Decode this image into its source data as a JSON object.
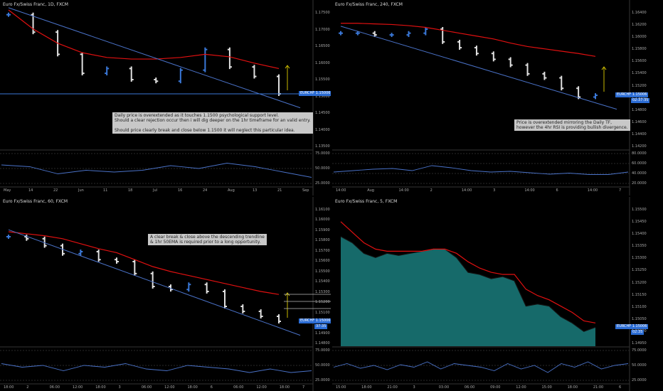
{
  "panels": [
    {
      "title": "Euro Fx/Swiss Franc, 1D, FXCM",
      "symbol": "EURCHF",
      "price": "1.15006",
      "countdown": "",
      "note": "Daily price is overextended as it touches 1.1500 psychological support level.\nShould a clear rejection occur then i will dig deeper on the 1hr timeframe for an valid entry.\n\nShould price clearly break and close below 1.1500 it will neglect this particular idea.",
      "yticks": [
        "1.17500",
        "1.17000",
        "1.16500",
        "1.16000",
        "1.15500",
        "1.15000",
        "1.14500",
        "1.14000",
        "1.13500"
      ],
      "osc_ticks": [
        "75.0000",
        "50.0000",
        "25.0000"
      ],
      "xticks": [
        "May",
        "14",
        "22",
        "Jun",
        "11",
        "18",
        "Jul",
        "16",
        "24",
        "Aug",
        "13",
        "21",
        "Sep"
      ],
      "fibs": []
    },
    {
      "title": "Euro Fx/Swiss Franc, 240, FXCM",
      "symbol": "EURCHF",
      "price": "1.15006",
      "countdown": "02:37:35",
      "note": "Price is overextended mirroring the Daily TF,\nhowever the 4hr RSI is providing bullish divergence.",
      "yticks": [
        "1.16400",
        "1.16200",
        "1.16000",
        "1.15800",
        "1.15600",
        "1.15400",
        "1.15200",
        "1.15000",
        "1.14800",
        "1.14600",
        "1.14400",
        "1.14200"
      ],
      "osc_ticks": [
        "80.0000",
        "60.0000",
        "40.0000",
        "20.0000"
      ],
      "xticks": [
        "14:00",
        "Aug",
        "14:00",
        "2",
        "14:00",
        "3",
        "14:00",
        "6",
        "14:00",
        "7"
      ],
      "fibs": []
    },
    {
      "title": "Euro Fx/Swiss Franc, 60, FXCM",
      "symbol": "EURCHF",
      "price": "1.15006",
      "countdown": "37:35",
      "note": "A clear break & close above the descending trendline\n& 1hr 50EMA is required prior to a long opportunity.",
      "yticks": [
        "1.16100",
        "1.16000",
        "1.15900",
        "1.15800",
        "1.15700",
        "1.15600",
        "1.15500",
        "1.15400",
        "1.15300",
        "1.15200",
        "1.15100",
        "1.15000",
        "1.14900",
        "1.14800"
      ],
      "osc_ticks": [
        "75.0000",
        "50.0000",
        "25.0000"
      ],
      "xticks": [
        "18:00",
        "2",
        "06:00",
        "12:00",
        "18:00",
        "3",
        "06:00",
        "12:00",
        "18:00",
        "6",
        "06:00",
        "12:00",
        "18:00",
        "7"
      ],
      "fibs": [
        "38.20%",
        "50.00%",
        "61.80%"
      ]
    },
    {
      "title": "Euro Fx/Swiss Franc, 5, FXCM",
      "symbol": "EURCHF",
      "price": "1.15006",
      "countdown": "02:35",
      "note": "",
      "yticks": [
        "1.15500",
        "1.15450",
        "1.15400",
        "1.15350",
        "1.15300",
        "1.15250",
        "1.15200",
        "1.15150",
        "1.15100",
        "1.15050",
        "1.15000",
        "1.14950"
      ],
      "osc_ticks": [
        "75.0000",
        "50.0000",
        "25.0000"
      ],
      "xticks": [
        "15:00",
        "18:00",
        "21:00",
        "3",
        "03:00",
        "06:00",
        "09:00",
        "12:00",
        "15:00",
        "18:00",
        "21:00",
        "6"
      ],
      "fibs": []
    }
  ],
  "chart_data": [
    {
      "type": "bar",
      "title": "Euro Fx/Swiss Franc, 1D, FXCM",
      "x": [
        "May",
        "14",
        "22",
        "Jun",
        "11",
        "18",
        "Jul",
        "16",
        "24",
        "Aug"
      ],
      "series": [
        {
          "values": [
            1.1765,
            1.171,
            1.164,
            1.158,
            1.1595,
            1.156,
            1.1555,
            1.159,
            1.1655,
            1.16,
            1.157,
            1.1515
          ]
        }
      ],
      "ema": [
        1.178,
        1.172,
        1.1675,
        1.1645,
        1.163,
        1.1625,
        1.1625,
        1.163,
        1.164,
        1.1632,
        1.1612,
        1.1595
      ],
      "osc": [
        60,
        55,
        35,
        45,
        40,
        45,
        58,
        50,
        65,
        55,
        40,
        25
      ],
      "ylim": [
        1.134,
        1.178
      ]
    },
    {
      "type": "bar",
      "title": "Euro Fx/Swiss Franc, 240, FXCM",
      "series": [
        {
          "values": [
            1.1615,
            1.1615,
            1.1612,
            1.1612,
            1.1615,
            1.1622,
            1.16,
            1.159,
            1.158,
            1.157,
            1.156,
            1.1545,
            1.1538,
            1.152,
            1.1505,
            1.1508
          ]
        }
      ],
      "ema": [
        1.1632,
        1.1632,
        1.1631,
        1.163,
        1.1628,
        1.1625,
        1.162,
        1.1615,
        1.161,
        1.1605,
        1.1598,
        1.1592,
        1.1588,
        1.1584,
        1.158,
        1.1575
      ],
      "osc": [
        40,
        44,
        48,
        50,
        44,
        58,
        52,
        44,
        40,
        42,
        38,
        34,
        37,
        33,
        33,
        40
      ],
      "ylim": [
        1.1415,
        1.1655
      ]
    },
    {
      "type": "bar",
      "title": "Euro Fx/Swiss Franc, 60, FXCM",
      "series": [
        {
          "values": [
            1.1585,
            1.1583,
            1.1576,
            1.1568,
            1.157,
            1.1562,
            1.156,
            1.1548,
            1.1535,
            1.1532,
            1.1537,
            1.153,
            1.1515,
            1.151,
            1.1505,
            1.15
          ]
        }
      ],
      "ema": [
        1.159,
        1.1588,
        1.1586,
        1.1583,
        1.1578,
        1.1573,
        1.1569,
        1.1562,
        1.1555,
        1.155,
        1.1546,
        1.1542,
        1.1538,
        1.1534,
        1.153,
        1.1527
      ],
      "osc": [
        55,
        45,
        50,
        35,
        50,
        45,
        55,
        40,
        35,
        50,
        45,
        40,
        30,
        40,
        30,
        35
      ],
      "ylim": [
        1.1475,
        1.1615
      ]
    },
    {
      "type": "area",
      "title": "Euro Fx/Swiss Franc, 5, FXCM",
      "series": [
        {
          "values": [
            1.1543,
            1.154,
            1.1535,
            1.1533,
            1.1535,
            1.1534,
            1.1535,
            1.1536,
            1.1537,
            1.1537,
            1.1533,
            1.1526,
            1.1525,
            1.1523,
            1.1524,
            1.1522,
            1.151,
            1.1511,
            1.151,
            1.1505,
            1.1502,
            1.1498,
            1.15
          ]
        }
      ],
      "ema": [
        1.155,
        1.1545,
        1.154,
        1.1537,
        1.1536,
        1.1536,
        1.1536,
        1.1536,
        1.1537,
        1.1537,
        1.1535,
        1.1531,
        1.1528,
        1.1526,
        1.1525,
        1.1525,
        1.1518,
        1.1515,
        1.1513,
        1.151,
        1.1507,
        1.1503,
        1.1502
      ],
      "osc": [
        45,
        55,
        42,
        50,
        38,
        52,
        45,
        60,
        40,
        55,
        50,
        45,
        35,
        55,
        40,
        50,
        30,
        55,
        45,
        60,
        40,
        50,
        55
      ],
      "ylim": [
        1.1491,
        1.1557
      ]
    }
  ],
  "colors": {
    "up": "#3a78d8",
    "down": "#e0e0e0",
    "ema": "#e01010",
    "trend": "#4a72c8",
    "target": "#c8b800",
    "area": "#1e8e8e",
    "osc": "#4a72c8",
    "price_line": "#3a78d8"
  }
}
